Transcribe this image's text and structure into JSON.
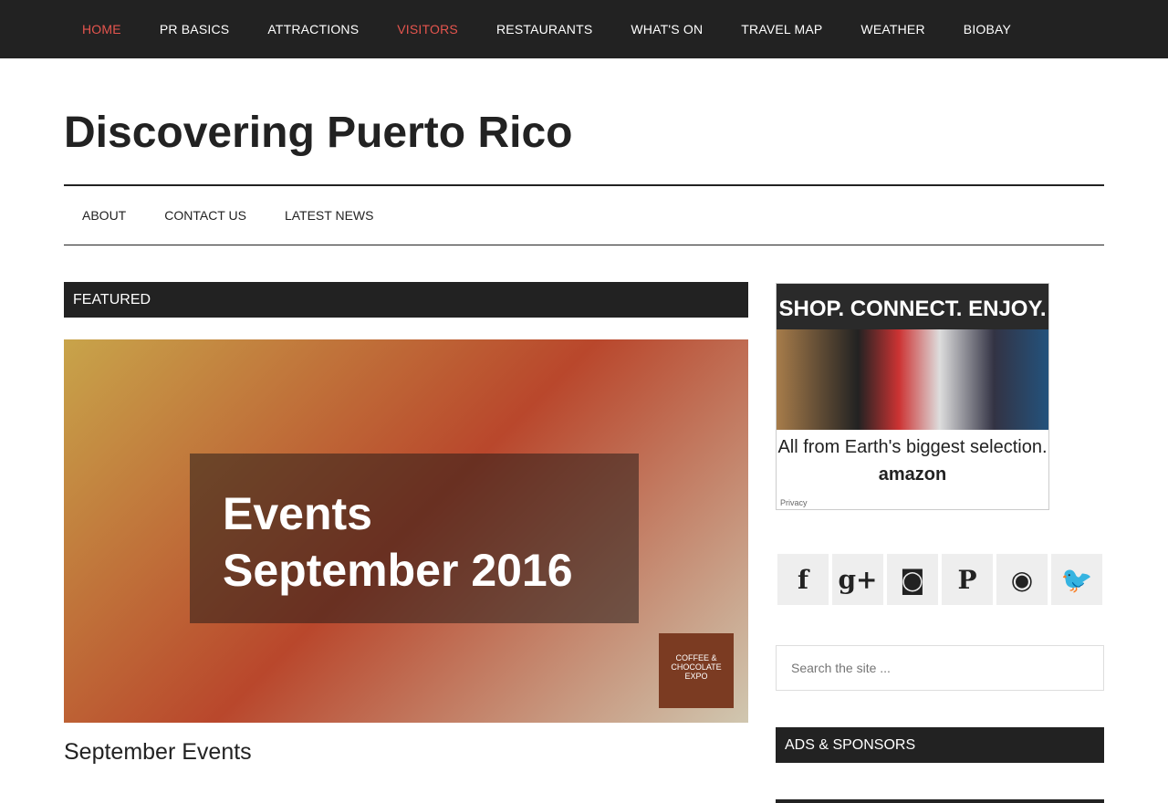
{
  "top_nav": [
    {
      "label": "HOME"
    },
    {
      "label": "PR BASICS"
    },
    {
      "label": "ATTRACTIONS"
    },
    {
      "label": "VISITORS"
    },
    {
      "label": "RESTAURANTS"
    },
    {
      "label": "WHAT'S ON"
    },
    {
      "label": "TRAVEL MAP"
    },
    {
      "label": "WEATHER"
    },
    {
      "label": "BIOBAY"
    }
  ],
  "site_title": "Discovering Puerto Rico",
  "sub_nav": [
    {
      "label": "ABOUT"
    },
    {
      "label": "CONTACT US"
    },
    {
      "label": "LATEST NEWS"
    }
  ],
  "featured": {
    "heading": "FEATURED",
    "image_text_1": "Events",
    "image_text_2": "September 2016",
    "image_logo": "COFFEE & CHOCOLATE EXPO",
    "post_title": "September Events"
  },
  "ad": {
    "headline": "SHOP. CONNECT. ENJOY.",
    "tagline": "All from Earth's biggest selection.",
    "brand": "amazon",
    "privacy": "Privacy"
  },
  "social": [
    "f",
    "g+",
    "◙",
    "P",
    "◉",
    "🐦"
  ],
  "search": {
    "placeholder": "Search the site ..."
  },
  "ads_heading": "ADS & SPONSORS",
  "colors": {
    "accent": "#e5554e",
    "dark": "#222222"
  }
}
